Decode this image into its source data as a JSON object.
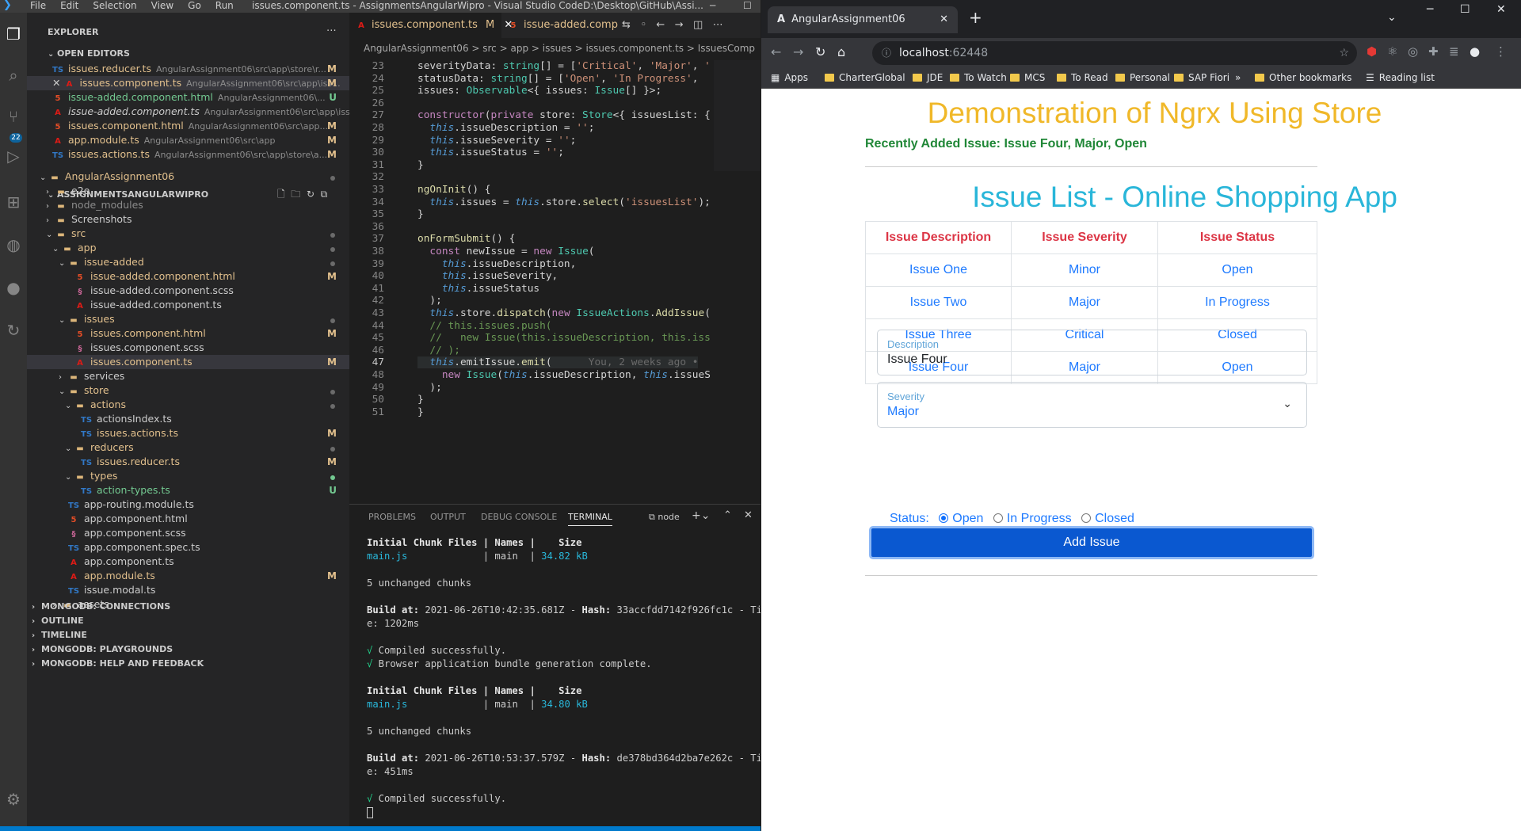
{
  "vscode": {
    "menu": [
      "File",
      "Edit",
      "Selection",
      "View",
      "Go",
      "Run"
    ],
    "window_title": "issues.component.ts - AssignmentsAngularWipro - Visual Studio CodeD:\\Desktop\\GitHub\\Assi...",
    "scm_badge": "22",
    "explorer_title": "EXPLORER",
    "open_editors_title": "OPEN EDITORS",
    "open_editors": [
      {
        "icon": "TS",
        "name": "issues.reducer.ts",
        "path": "AngularAssignment06\\src\\app\\store\\r...",
        "status": "M"
      },
      {
        "icon": "NG",
        "name": "issues.component.ts",
        "path": "AngularAssignment06\\src\\app\\iss...",
        "status": "M"
      },
      {
        "icon": "HTML",
        "name": "issue-added.component.html",
        "path": "AngularAssignment06\\...",
        "status": "U"
      },
      {
        "icon": "NG",
        "name": "issue-added.component.ts",
        "path": "AngularAssignment06\\src\\app\\issu...",
        "status": ""
      },
      {
        "icon": "HTML",
        "name": "issues.component.html",
        "path": "AngularAssignment06\\src\\app...",
        "status": "M"
      },
      {
        "icon": "NG",
        "name": "app.module.ts",
        "path": "AngularAssignment06\\src\\app",
        "status": "M"
      },
      {
        "icon": "TS",
        "name": "issues.actions.ts",
        "path": "AngularAssignment06\\src\\app\\store\\a...",
        "status": "M"
      }
    ],
    "workspace_title": "ASSIGNMENTSANGULARWIPRO",
    "tree": [
      {
        "name": "AngularAssignment06",
        "type": "folder",
        "status": "dot"
      },
      {
        "name": "e2e",
        "type": "folder",
        "status": ""
      },
      {
        "name": "node_modules",
        "type": "folder",
        "status": ""
      },
      {
        "name": "Screenshots",
        "type": "folder",
        "status": ""
      },
      {
        "name": "src",
        "type": "folder",
        "status": "dot"
      },
      {
        "name": "app",
        "type": "folder",
        "status": "dot"
      },
      {
        "name": "issue-added",
        "type": "folder",
        "status": "dot"
      },
      {
        "name": "issue-added.component.html",
        "type": "html",
        "status": "M"
      },
      {
        "name": "issue-added.component.scss",
        "type": "scss",
        "status": ""
      },
      {
        "name": "issue-added.component.ts",
        "type": "ng",
        "status": ""
      },
      {
        "name": "issues",
        "type": "folder",
        "status": "dot"
      },
      {
        "name": "issues.component.html",
        "type": "html",
        "status": "M"
      },
      {
        "name": "issues.component.scss",
        "type": "scss",
        "status": ""
      },
      {
        "name": "issues.component.ts",
        "type": "ng",
        "status": "M"
      },
      {
        "name": "services",
        "type": "folder",
        "status": ""
      },
      {
        "name": "store",
        "type": "folder",
        "status": "dot"
      },
      {
        "name": "actions",
        "type": "folder",
        "status": "dot"
      },
      {
        "name": "actionsIndex.ts",
        "type": "ts",
        "status": ""
      },
      {
        "name": "issues.actions.ts",
        "type": "ts",
        "status": "M"
      },
      {
        "name": "reducers",
        "type": "folder",
        "status": "dot"
      },
      {
        "name": "issues.reducer.ts",
        "type": "ts",
        "status": "M"
      },
      {
        "name": "types",
        "type": "folder",
        "status": "dot"
      },
      {
        "name": "action-types.ts",
        "type": "ts",
        "status": "U"
      },
      {
        "name": "app-routing.module.ts",
        "type": "ts",
        "status": ""
      },
      {
        "name": "app.component.html",
        "type": "html",
        "status": ""
      },
      {
        "name": "app.component.scss",
        "type": "scss",
        "status": ""
      },
      {
        "name": "app.component.spec.ts",
        "type": "ts",
        "status": ""
      },
      {
        "name": "app.component.ts",
        "type": "ng",
        "status": ""
      },
      {
        "name": "app.module.ts",
        "type": "ng",
        "status": "M"
      },
      {
        "name": "issue.modal.ts",
        "type": "ts",
        "status": ""
      },
      {
        "name": "assets",
        "type": "folder",
        "status": ""
      }
    ],
    "bottom_sections": [
      "MONGODB: CONNECTIONS",
      "OUTLINE",
      "TIMELINE",
      "MONGODB: PLAYGROUNDS",
      "MONGODB: HELP AND FEEDBACK"
    ],
    "tabs": [
      {
        "label": "issues.component.ts",
        "status": "M"
      },
      {
        "label": "issue-added.comp",
        "status": ""
      }
    ],
    "breadcrumb": "AngularAssignment06 > src > app > issues > issues.component.ts > IssuesComp",
    "code": [
      {
        "n": "23",
        "text": "severityData: string[] = ['Critical', 'Major', '"
      },
      {
        "n": "24",
        "text": "statusData: string[] = ['Open', 'In Progress',"
      },
      {
        "n": "25",
        "text": "issues: Observable<{ issues: Issue[] }>;"
      },
      {
        "n": "26",
        "text": ""
      },
      {
        "n": "27",
        "text": "constructor(private store: Store<{ issuesList: {"
      },
      {
        "n": "28",
        "text": "  this.issueDescription = '';"
      },
      {
        "n": "29",
        "text": "  this.issueSeverity = '';"
      },
      {
        "n": "30",
        "text": "  this.issueStatus = '';"
      },
      {
        "n": "31",
        "text": "}"
      },
      {
        "n": "32",
        "text": ""
      },
      {
        "n": "33",
        "text": "ngOnInit() {"
      },
      {
        "n": "34",
        "text": "  this.issues = this.store.select('issuesList');"
      },
      {
        "n": "35",
        "text": "}"
      },
      {
        "n": "36",
        "text": ""
      },
      {
        "n": "37",
        "text": "onFormSubmit() {"
      },
      {
        "n": "38",
        "text": "  const newIssue = new Issue("
      },
      {
        "n": "39",
        "text": "    this.issueDescription,"
      },
      {
        "n": "40",
        "text": "    this.issueSeverity,"
      },
      {
        "n": "41",
        "text": "    this.issueStatus"
      },
      {
        "n": "42",
        "text": "  );"
      },
      {
        "n": "43",
        "text": "  this.store.dispatch(new IssueActions.AddIssue("
      },
      {
        "n": "44",
        "text": "  // this.issues.push("
      },
      {
        "n": "45",
        "text": "  //   new Issue(this.issueDescription, this.iss"
      },
      {
        "n": "46",
        "text": "  // );"
      },
      {
        "n": "47",
        "text": "  this.emitIssue.emit(      You, 2 weeks ago •"
      },
      {
        "n": "48",
        "text": "    new Issue(this.issueDescription, this.issueS"
      },
      {
        "n": "49",
        "text": "  );"
      },
      {
        "n": "50",
        "text": "}"
      },
      {
        "n": "51",
        "text": "}"
      }
    ],
    "panel_tabs": [
      "PROBLEMS",
      "OUTPUT",
      "DEBUG CONSOLE",
      "TERMINAL"
    ],
    "terminal_name": "node",
    "terminal": [
      "Initial Chunk Files | Names |    Size",
      "main.js             | main  | 34.82 kB",
      "",
      "5 unchanged chunks",
      "",
      "Build at: 2021-06-26T10:42:35.681Z - Hash: 33accfdd7142f926fc1c - Tim",
      "e: 1202ms",
      "",
      "√ Compiled successfully.",
      "√ Browser application bundle generation complete.",
      "",
      "Initial Chunk Files | Names |    Size",
      "main.js             | main  | 34.80 kB",
      "",
      "5 unchanged chunks",
      "",
      "Build at: 2021-06-26T10:53:37.579Z - Hash: de378bd364d2ba7e262c - Tim",
      "e: 451ms",
      "",
      "√ Compiled successfully."
    ]
  },
  "browser": {
    "tab_title": "AngularAssignment06",
    "url_host": "localhost",
    "url_port": ":62448",
    "bookmarks": [
      "Apps",
      "CharterGlobal",
      "JDE",
      "To Watch",
      "MCS",
      "To Read",
      "Personal",
      "SAP Fiori"
    ],
    "bookmarks_more": "»",
    "other_bookmarks": "Other bookmarks",
    "reading_list": "Reading list",
    "page": {
      "title": "Demonstration of Ngrx Using Store",
      "recent": "Recently Added Issue: Issue Four, Major, Open",
      "list_title": "Issue List - Online Shopping App",
      "columns": [
        "Issue Description",
        "Issue Severity",
        "Issue Status"
      ],
      "rows": [
        [
          "Issue One",
          "Minor",
          "Open"
        ],
        [
          "Issue Two",
          "Major",
          "In Progress"
        ],
        [
          "Issue Three",
          "Critical",
          "Closed"
        ],
        [
          "Issue Four",
          "Major",
          "Open"
        ]
      ],
      "description_label": "Description",
      "description_value": "Issue Four",
      "severity_label": "Severity",
      "severity_value": "Major",
      "status_label": "Status:",
      "status_options": [
        "Open",
        "In Progress",
        "Closed"
      ],
      "status_selected": "Open",
      "add_button": "Add Issue"
    }
  }
}
